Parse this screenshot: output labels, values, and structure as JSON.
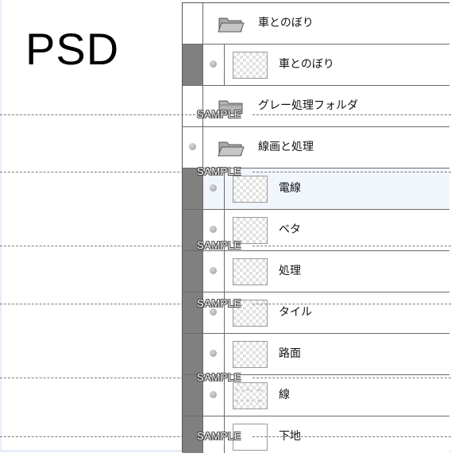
{
  "format_label": "PSD",
  "watermark_text": "SAMPLE",
  "layers": [
    {
      "name": "車とのぼり",
      "kind": "group",
      "row": "group-open",
      "strip": "light"
    },
    {
      "name": "車とのぼり",
      "kind": "layer",
      "row": "indented",
      "strip": "dark",
      "thumb": "checker"
    },
    {
      "name": "グレー処理フォルダ",
      "kind": "group",
      "row": "group-closed",
      "strip": "light"
    },
    {
      "name": "線画と処理",
      "kind": "group",
      "row": "group-visible",
      "strip": "light"
    },
    {
      "name": "電線",
      "kind": "layer",
      "row": "indented",
      "strip": "dark",
      "thumb": "checker",
      "selected": true
    },
    {
      "name": "ベタ",
      "kind": "layer",
      "row": "indented",
      "strip": "dark",
      "thumb": "checker"
    },
    {
      "name": "処理",
      "kind": "layer",
      "row": "indented",
      "strip": "dark",
      "thumb": "checker"
    },
    {
      "name": "タイル",
      "kind": "layer",
      "row": "indented",
      "strip": "dark",
      "thumb": "checker"
    },
    {
      "name": "路面",
      "kind": "layer",
      "row": "indented",
      "strip": "dark",
      "thumb": "checker"
    },
    {
      "name": "線",
      "kind": "layer",
      "row": "indented",
      "strip": "dark",
      "thumb": "texture"
    },
    {
      "name": "下地",
      "kind": "layer",
      "row": "indented",
      "strip": "dark",
      "thumb": "plain"
    }
  ],
  "colors": {
    "strip_dark": "#808080",
    "selected_row": "#f1f5fc",
    "border": "#6a6a6a",
    "folder": "#9b9b9b"
  }
}
